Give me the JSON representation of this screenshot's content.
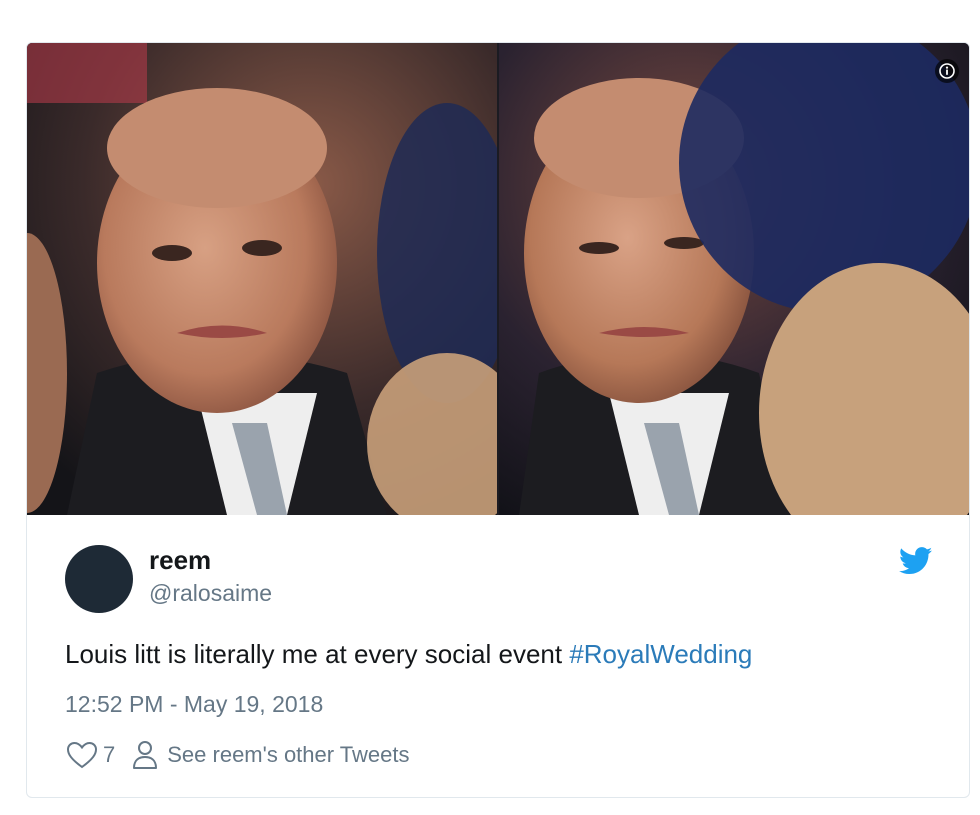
{
  "media": {
    "images": [
      {
        "description": "man-face-left"
      },
      {
        "description": "man-face-right"
      }
    ],
    "info_icon": "info-icon"
  },
  "tweet": {
    "author_name": "reem",
    "author_handle": "@ralosaime",
    "text": "Louis litt is literally me at every social event ",
    "hashtag": "#RoyalWedding",
    "timestamp": "12:52 PM - May 19, 2018",
    "like_count": "7",
    "profile_link": "See reem's other Tweets"
  },
  "icons": {
    "brand": "twitter-bird-icon",
    "like": "heart-icon",
    "profile": "person-icon"
  },
  "colors": {
    "link": "#2b7bb9",
    "twitter_blue": "#1da1f2",
    "secondary_text": "#657786",
    "primary_text": "#14171a",
    "border": "#e1e8ed"
  }
}
